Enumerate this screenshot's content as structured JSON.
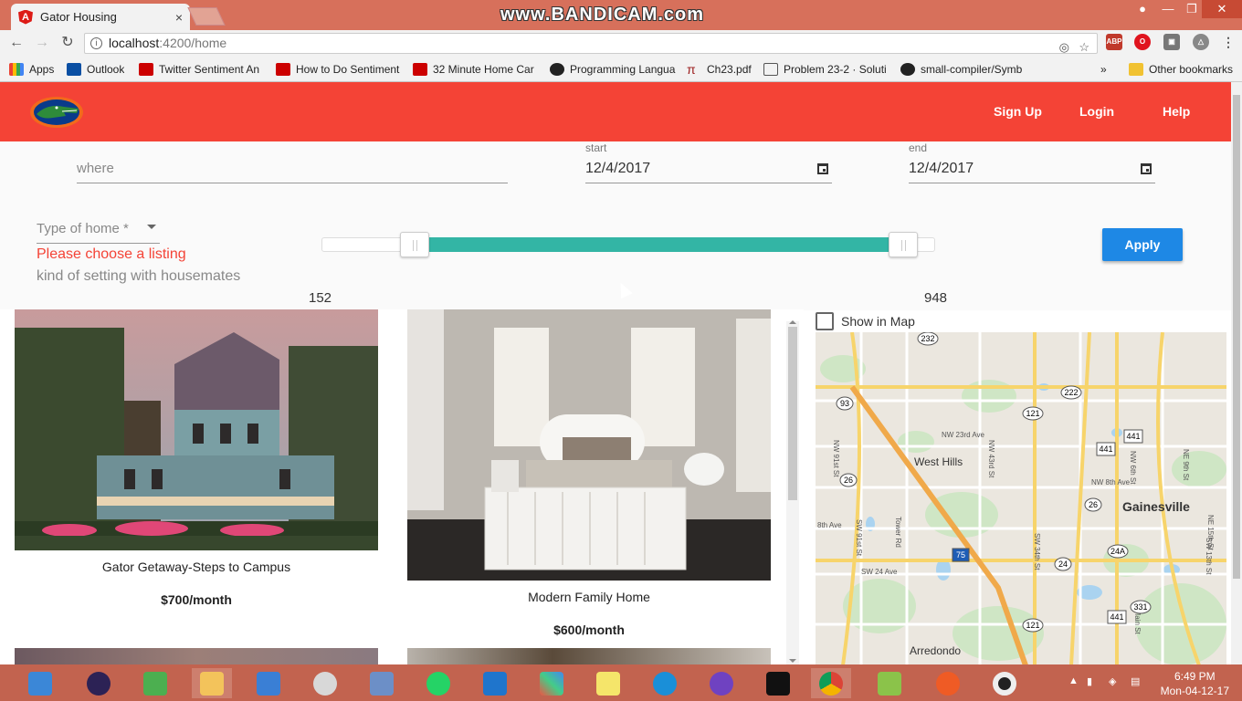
{
  "browser": {
    "tab_title": "Gator Housing",
    "tab_close": "×",
    "watermark": "www.BANDICAM.com",
    "url_host": "localhost",
    "url_path": ":4200/home",
    "bookmarks": [
      {
        "label": "Apps",
        "color": "#3d6fd6"
      },
      {
        "label": "Outlook",
        "color": "#0a4fa3"
      },
      {
        "label": "Twitter Sentiment An",
        "color": "#cc0000"
      },
      {
        "label": "How to Do Sentiment",
        "color": "#cc0000"
      },
      {
        "label": "32 Minute Home Car",
        "color": "#cc0000"
      },
      {
        "label": "Programming Langua",
        "color": "#7a1b1b"
      },
      {
        "label": "Ch23.pdf",
        "color": "#9b1b1b"
      },
      {
        "label": "Problem 23-2 · Soluti",
        "color": "#555555"
      },
      {
        "label": "small-compiler/Symb",
        "color": "#222222"
      }
    ],
    "more_bookmarks": "»",
    "other_bookmarks": "Other bookmarks"
  },
  "header": {
    "logo": "gator-logo",
    "links": [
      "Sign Up",
      "Login",
      "Help"
    ],
    "bg_color": "#f44336"
  },
  "search": {
    "where_placeholder": "where",
    "start_label": "start",
    "start_value": "12/4/2017",
    "end_label": "end",
    "end_value": "12/4/2017",
    "type_label": "Type of home *",
    "error_text": "Please choose a listing",
    "hint_text": "kind of setting with housemates",
    "price_min": "152",
    "price_max": "948",
    "apply_label": "Apply"
  },
  "listings": [
    {
      "title": "Gator Getaway-Steps to Campus",
      "price": "$700/month"
    },
    {
      "title": "Modern Family Home",
      "price": "$600/month"
    }
  ],
  "map": {
    "checkbox_label": "Show in Map",
    "labels": [
      "West Hills",
      "Gainesville",
      "Arredondo",
      "NW 23rd Ave",
      "NW 8th Ave",
      "SW 24 Ave",
      "8th Ave",
      "SW 34th St",
      "Tower Rd",
      "NW 43rd St",
      "NW 91st St",
      "NW 6th St",
      "SW 91st St",
      "SW 13th St",
      "NE 9th St",
      "S Main St",
      "NE 15th St"
    ],
    "shields": [
      "232",
      "93",
      "222",
      "121",
      "441",
      "441",
      "26",
      "26",
      "75",
      "24A",
      "24",
      "331",
      "441",
      "121"
    ]
  },
  "taskbar": {
    "time": "6:49 PM",
    "date": "Mon-04-12-17"
  }
}
